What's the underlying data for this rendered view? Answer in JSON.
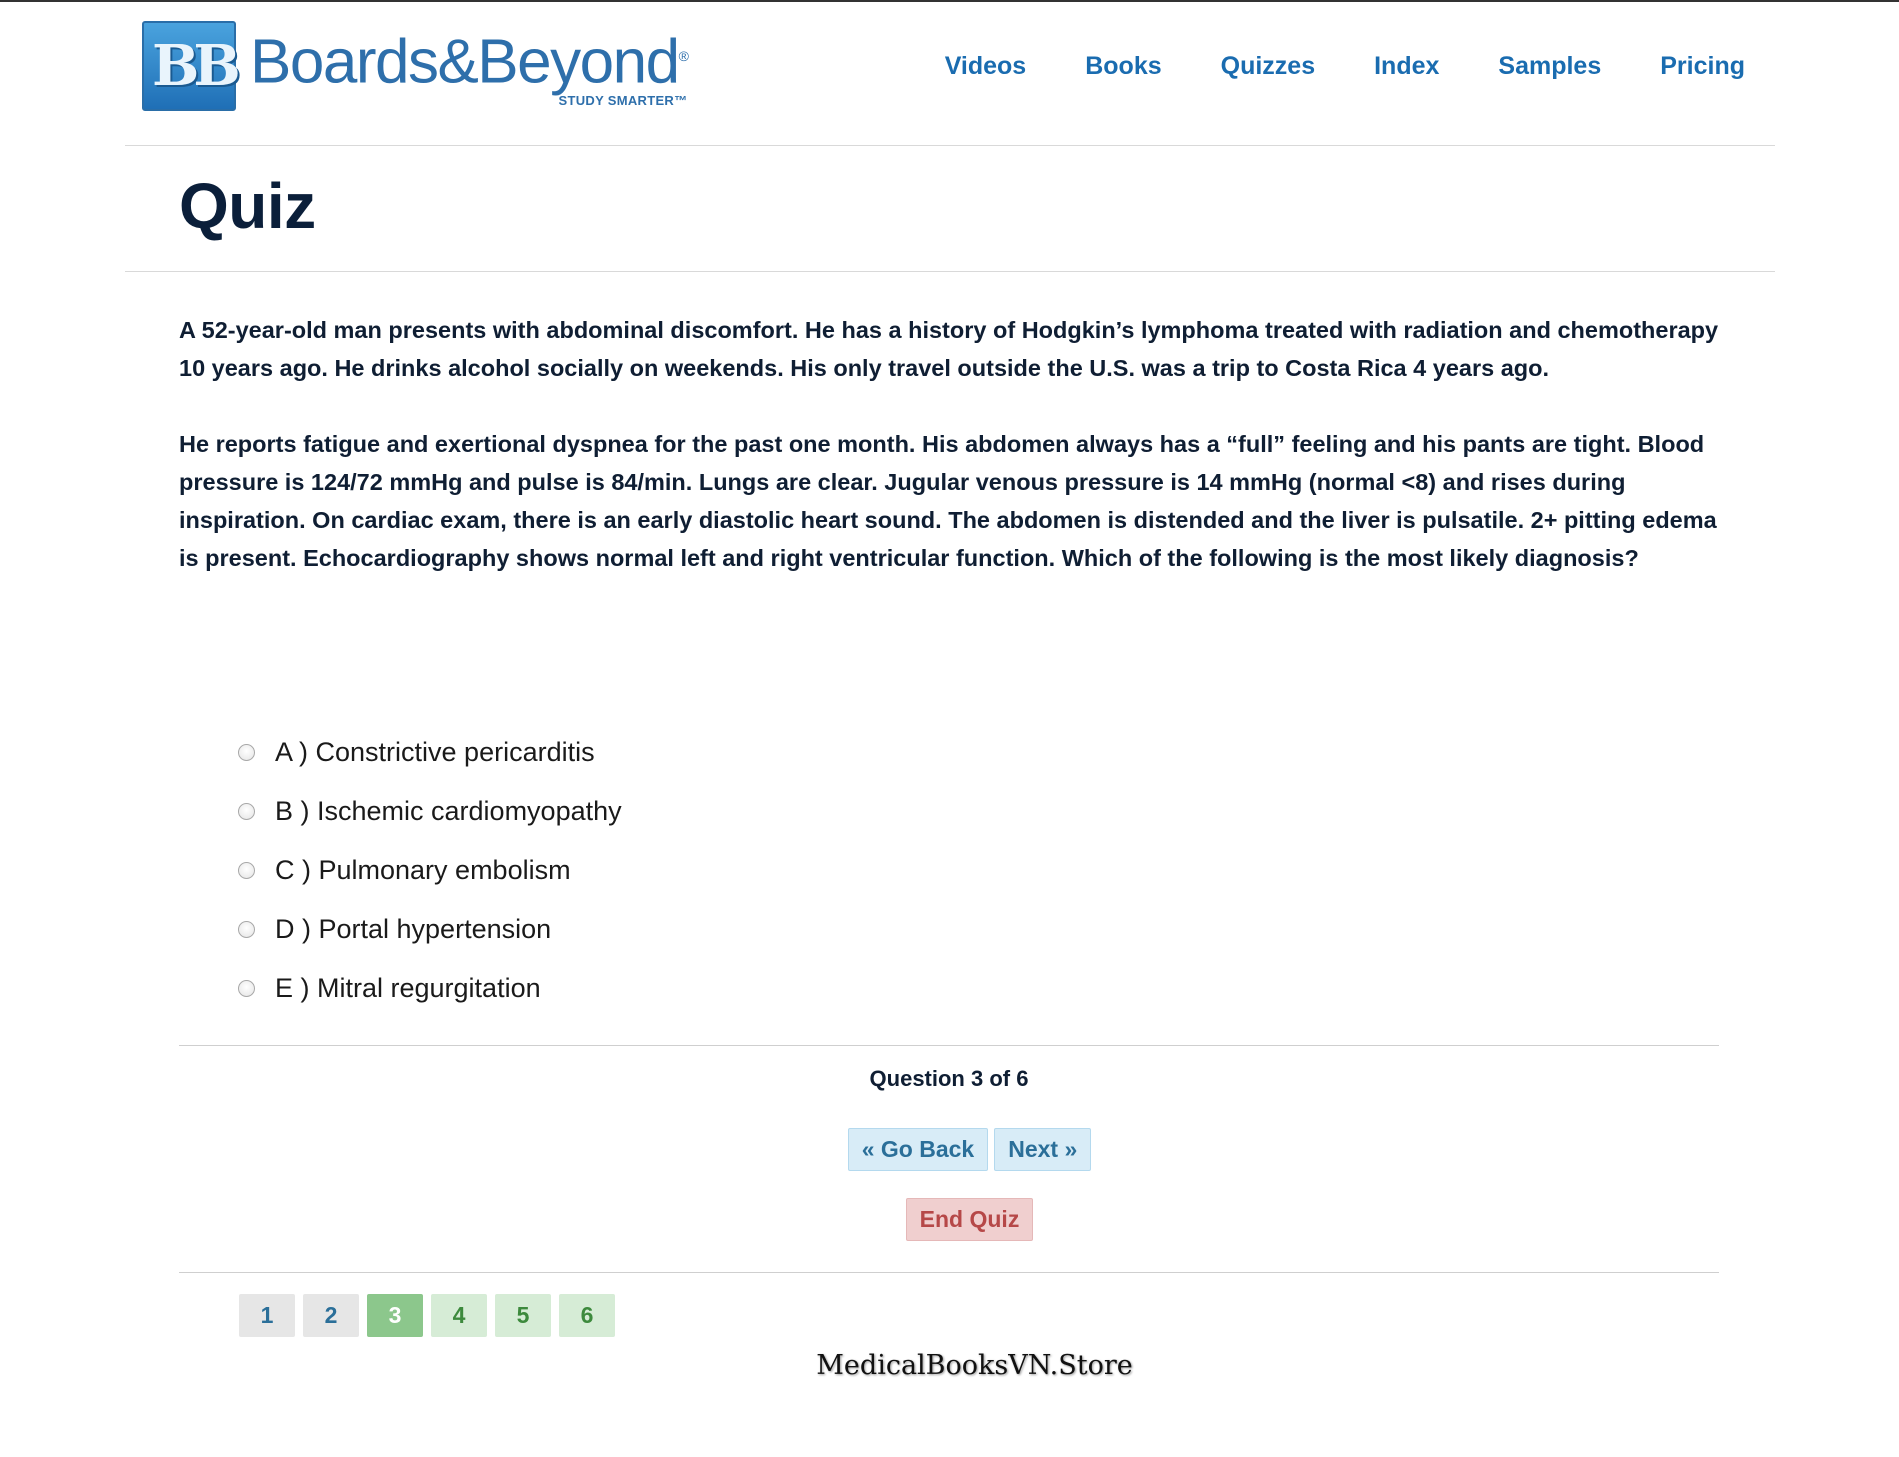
{
  "brand": {
    "name": "Boards&Beyond",
    "mark": "BB",
    "tagline": "STUDY SMARTER™",
    "registered": "®",
    "color": "#2e6fab"
  },
  "nav": {
    "items": [
      "Videos",
      "Books",
      "Quizzes",
      "Index",
      "Samples",
      "Pricing"
    ]
  },
  "page": {
    "title": "Quiz"
  },
  "question": {
    "paragraph1": "A 52-year-old man presents with abdominal discomfort. He has a history of Hodgkin’s lymphoma treated with radiation and chemotherapy 10 years ago. He drinks alcohol socially on weekends. His only travel outside the U.S. was a trip to Costa Rica 4 years ago.",
    "paragraph2": "He reports fatigue and exertional dyspnea for the past one month. His abdomen always has a “full” feeling and his pants are tight. Blood pressure is 124/72 mmHg and pulse is 84/min. Lungs are clear. Jugular venous pressure is 14 mmHg (normal <8) and rises during inspiration. On cardiac exam, there is an early diastolic heart sound. The abdomen is distended and the liver is pulsatile. 2+ pitting edema is present. Echocardiography shows normal left and right ventricular function. Which of the following is the most likely diagnosis?"
  },
  "options": [
    {
      "label": "A ) Constrictive pericarditis",
      "selected": false
    },
    {
      "label": "B ) Ischemic cardiomyopathy",
      "selected": false
    },
    {
      "label": "C ) Pulmonary embolism",
      "selected": false
    },
    {
      "label": "D ) Portal hypertension",
      "selected": false
    },
    {
      "label": "E ) Mitral regurgitation",
      "selected": false
    }
  ],
  "progress": {
    "text": "Question 3 of 6",
    "current": 3,
    "total": 6
  },
  "buttons": {
    "back": "« Go Back",
    "next": "Next »",
    "end": "End Quiz"
  },
  "pager": {
    "pages": [
      "1",
      "2",
      "3",
      "4",
      "5",
      "6"
    ]
  },
  "watermark": "MedicalBooksVN.Store",
  "colors": {
    "nav_link": "#1a6cb0",
    "current_page": "#8cc78c",
    "pending_page": "#d6ecd6",
    "visited_page": "#e6e6e6",
    "end_button": "#f0cfcf",
    "nav_button": "#d8ecf7"
  }
}
